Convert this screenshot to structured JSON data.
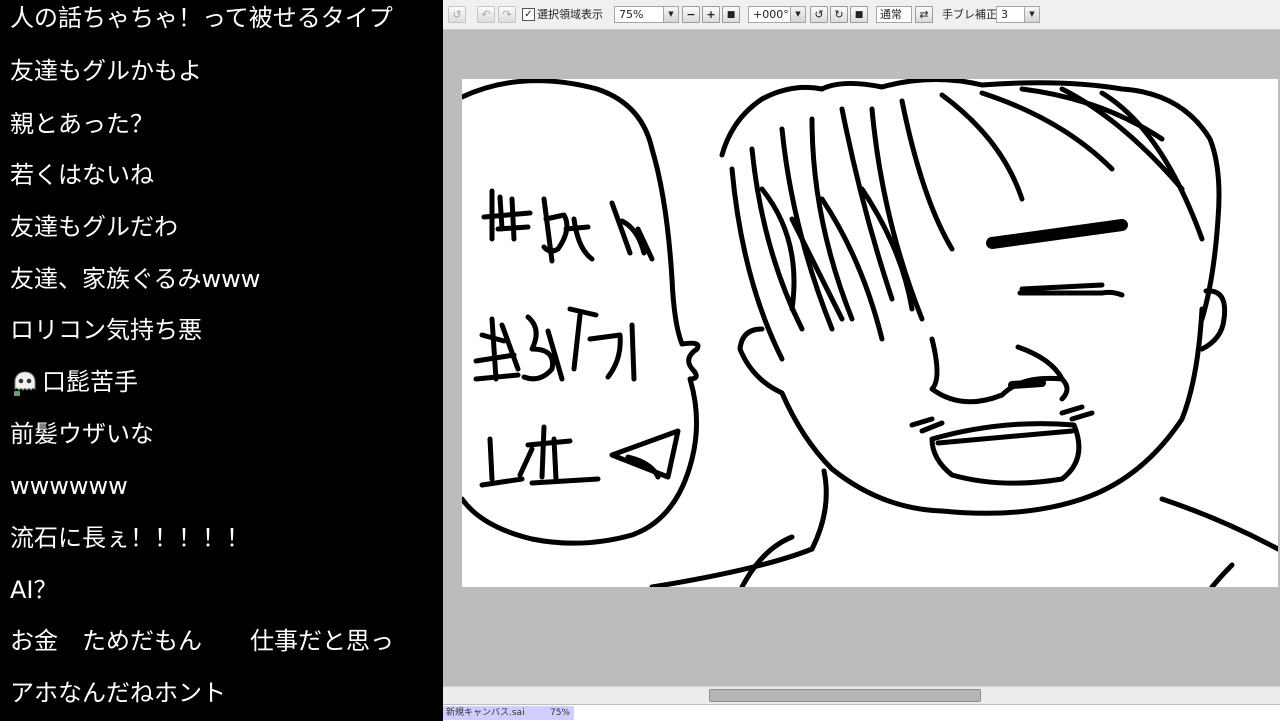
{
  "comments": [
    "人の話ちゃちゃ！って被せるタイプ",
    "友達もグルかもよ",
    "親とあった？",
    "若くはないね",
    "友達もグルだわ",
    "友達、家族ぐるみwww",
    "ロリコン気持ち悪",
    "口髭苦手",
    "前髪ウザいな",
    "wwwwww",
    "流石に長ぇ！！！！！",
    "AI？",
    "お金　ためだもん　　仕事だと思っ",
    "アホなんだねホント"
  ],
  "comment_icon": "ghost-avatar-icon",
  "toolbar": {
    "selection_label": "選択領域表示",
    "selection_checked": true,
    "zoom_value": "75%",
    "rotation_value": "+000°",
    "blend_mode_label": "通常",
    "stabilizer_label": "手ブレ補正",
    "stabilizer_value": "3"
  },
  "document_tab": {
    "name": "新規キャンバス.sai",
    "zoom": "75%"
  }
}
